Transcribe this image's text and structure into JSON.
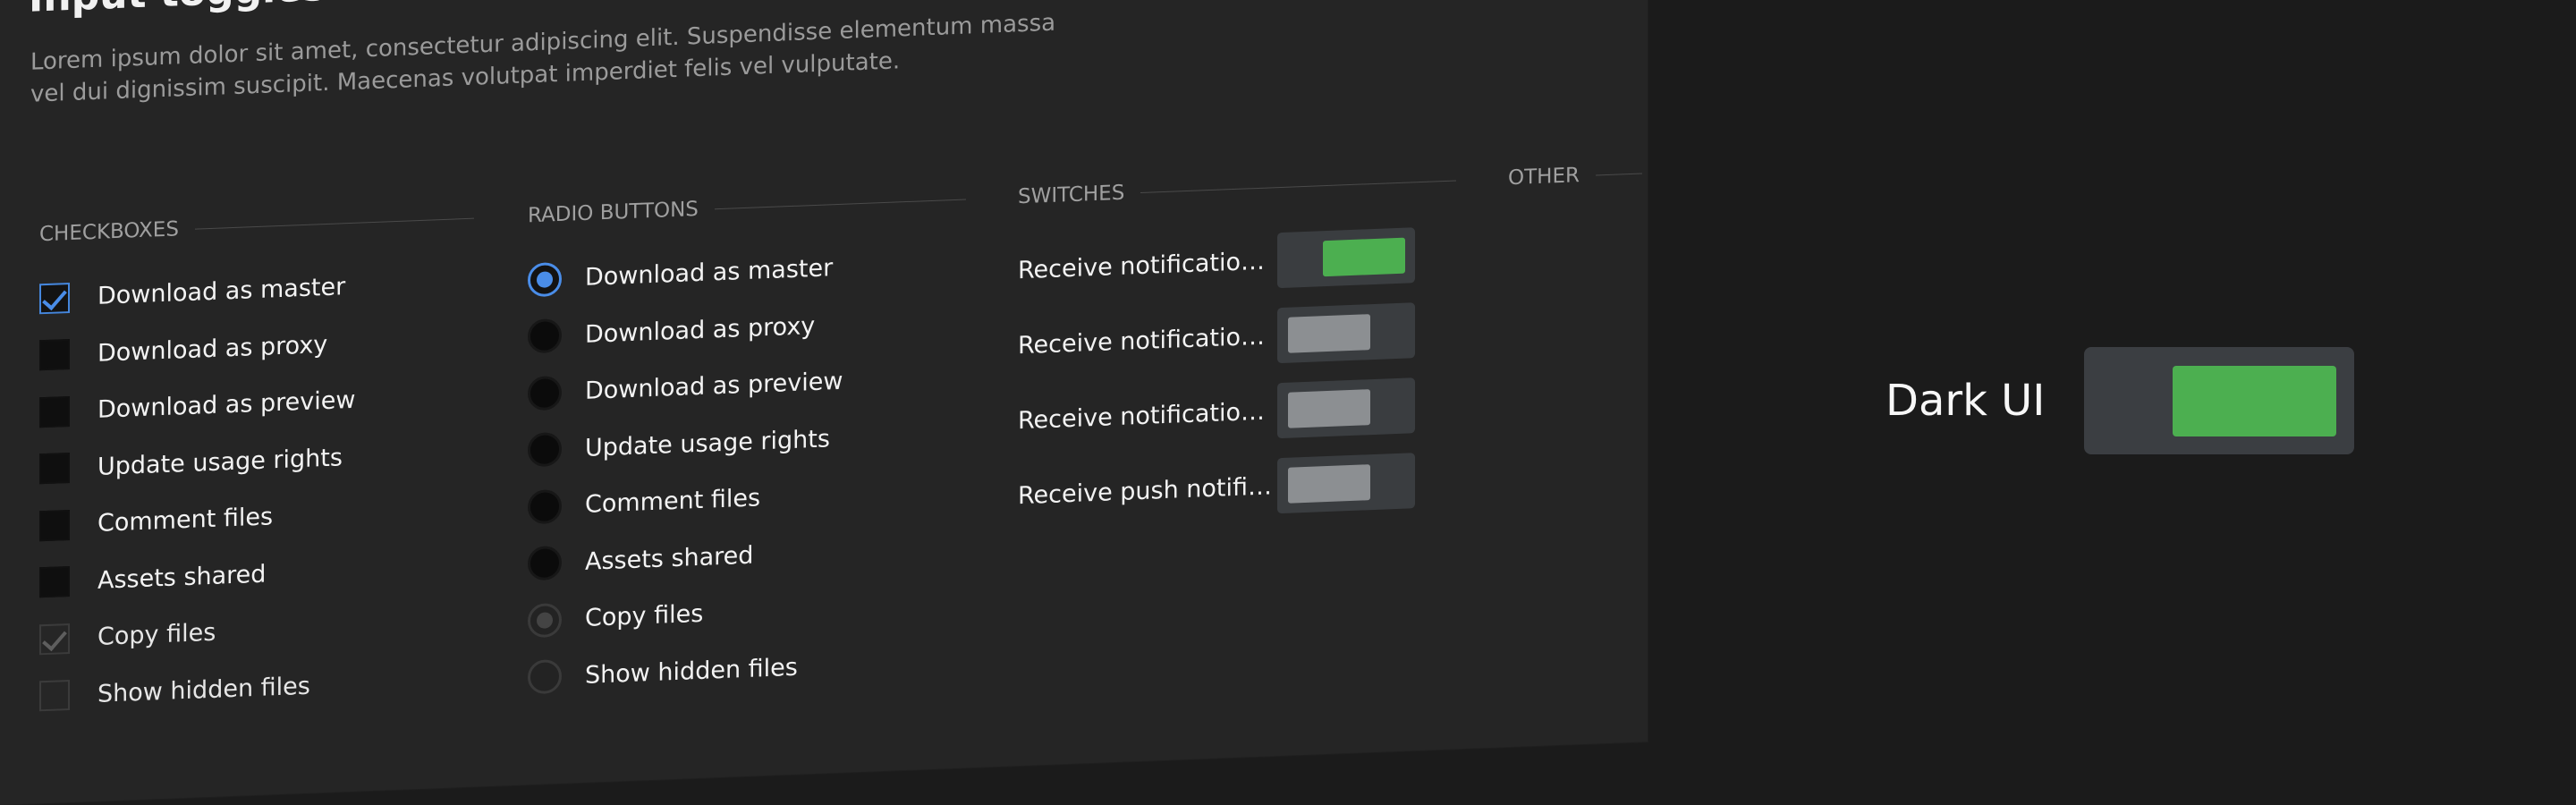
{
  "page": {
    "title": "Input toggles",
    "description": "Lorem ipsum dolor sit amet, consectetur adipiscing elit. Suspendisse elementum massa vel dui dignissim suscipit. Maecenas volutpat imperdiet felis vel vulputate."
  },
  "sections": {
    "checkboxes": {
      "title": "CHECKBOXES",
      "items": [
        {
          "label": "Download as master",
          "checked": true,
          "disabled": false
        },
        {
          "label": "Download as proxy",
          "checked": false,
          "disabled": false
        },
        {
          "label": "Download as preview",
          "checked": false,
          "disabled": false
        },
        {
          "label": "Update usage rights",
          "checked": false,
          "disabled": false
        },
        {
          "label": "Comment files",
          "checked": false,
          "disabled": false
        },
        {
          "label": "Assets shared",
          "checked": false,
          "disabled": false
        },
        {
          "label": "Copy files",
          "checked": true,
          "disabled": true
        },
        {
          "label": "Show hidden files",
          "checked": false,
          "disabled": true
        }
      ]
    },
    "radios": {
      "title": "RADIO BUTTONS",
      "items": [
        {
          "label": "Download as master",
          "checked": true,
          "disabled": false
        },
        {
          "label": "Download as proxy",
          "checked": false,
          "disabled": false
        },
        {
          "label": "Download as preview",
          "checked": false,
          "disabled": false
        },
        {
          "label": "Update usage rights",
          "checked": false,
          "disabled": false
        },
        {
          "label": "Comment files",
          "checked": false,
          "disabled": false
        },
        {
          "label": "Assets shared",
          "checked": false,
          "disabled": false
        },
        {
          "label": "Copy files",
          "checked": true,
          "disabled": true
        },
        {
          "label": "Show hidden files",
          "checked": false,
          "disabled": true
        }
      ]
    },
    "switches": {
      "title": "SWITCHES",
      "items": [
        {
          "label": "Receive notifications v...",
          "on": true
        },
        {
          "label": "Receive notifications v...",
          "on": false
        },
        {
          "label": "Receive notifications b...",
          "on": false
        },
        {
          "label": "Receive push notificati...",
          "on": false
        }
      ]
    },
    "other": {
      "title": "OTHER"
    }
  },
  "hero": {
    "label": "Dark UI",
    "switch_on": true
  },
  "colors": {
    "background": "#1b1b1b",
    "panel": "#252525",
    "accent_blue": "#4a8de8",
    "accent_green": "#4caf50",
    "muted_text": "#9b9b9b",
    "switch_track": "#3a3d40",
    "switch_thumb_off": "#8c8f92"
  },
  "icons": {
    "checked_checkbox": "checkmark-icon",
    "radio_selected": "radio-dot-icon"
  }
}
